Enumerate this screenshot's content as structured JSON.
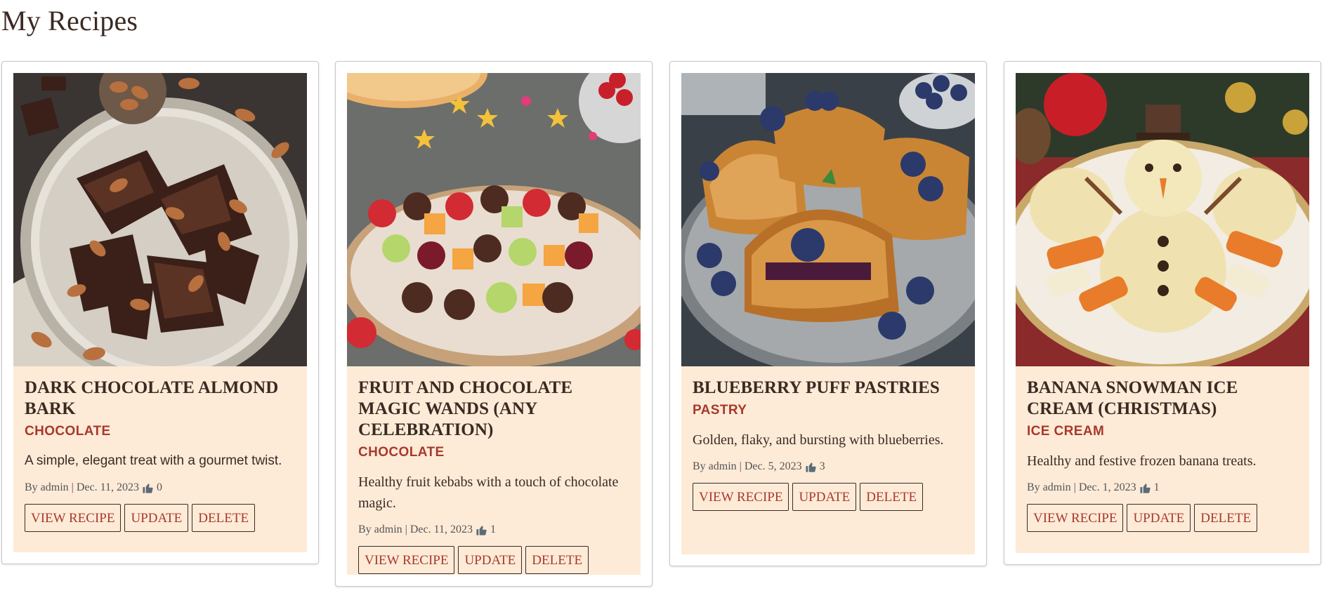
{
  "page": {
    "title": "My Recipes"
  },
  "buttons": {
    "view": "View Recipe",
    "update": "Update",
    "delete": "Delete"
  },
  "colors": {
    "card_bg": "#fdebd8",
    "accent": "#a8392b",
    "text": "#3b2a22"
  },
  "icons": {
    "likes": "thumbs-up-icon"
  },
  "recipes": [
    {
      "title": "Dark Chocolate Almond Bark",
      "category": "Chocolate",
      "description": "A simple, elegant treat with a gourmet twist.",
      "author": "By admin",
      "date": "Dec. 11, 2023",
      "likes": "0"
    },
    {
      "title": "Fruit and Chocolate Magic Wands (Any Celebration)",
      "category": "Chocolate",
      "description": "Healthy fruit kebabs with a touch of chocolate magic.",
      "author": "By admin",
      "date": "Dec. 11, 2023",
      "likes": "1"
    },
    {
      "title": "Blueberry Puff Pastries",
      "category": "Pastry",
      "description": "Golden, flaky, and bursting with blueberries.",
      "author": "By admin",
      "date": "Dec. 5, 2023",
      "likes": "3"
    },
    {
      "title": "Banana Snowman Ice Cream (Christmas)",
      "category": "Ice Cream",
      "description": "Healthy and festive frozen banana treats.",
      "author": "By admin",
      "date": "Dec. 1, 2023",
      "likes": "1"
    }
  ]
}
